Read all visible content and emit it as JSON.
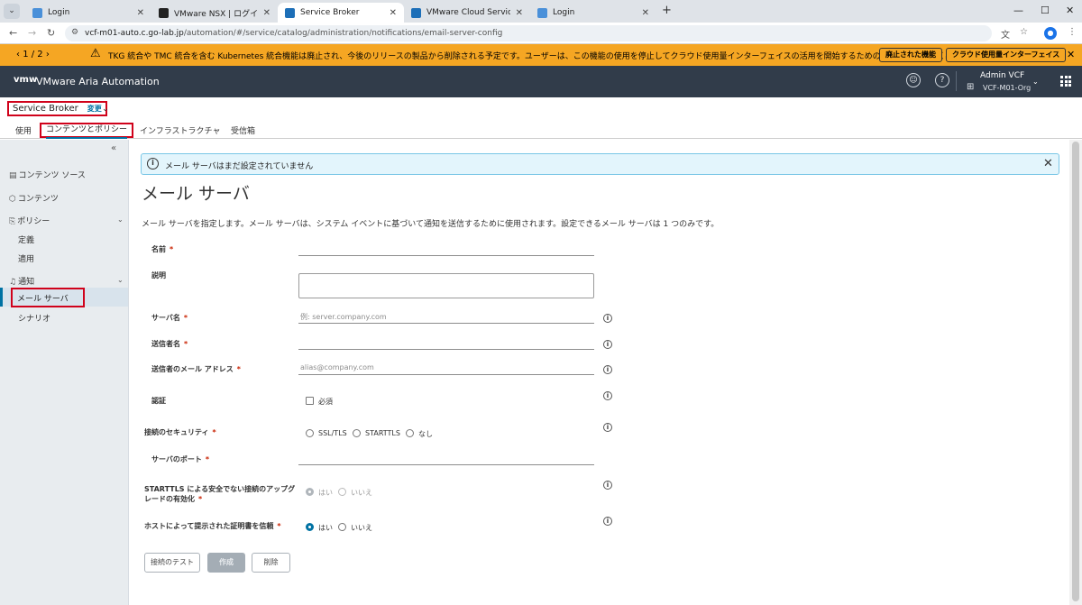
{
  "browser": {
    "tabs": [
      {
        "title": "Login",
        "favicon_color": "#4a90d9"
      },
      {
        "title": "VMware NSX | ログイン",
        "favicon_color": "#222222"
      },
      {
        "title": "Service Broker",
        "favicon_color": "#1d6fb8"
      },
      {
        "title": "VMware Cloud Services",
        "favicon_color": "#1d6fb8"
      },
      {
        "title": "Login",
        "favicon_color": "#4a90d9"
      }
    ],
    "url_host": "vcf-m01-auto.c.go-lab.jp",
    "url_path": "/automation/#/service/catalog/administration/notifications/email-server-config",
    "profile_initial": "👤"
  },
  "banner": {
    "pager": "1 / 2",
    "message": "TKG 統合や TMC 統合を含む Kubernetes 統合機能は廃止され、今後のリリースの製品から削除される予定です。ユーザーは、この機能の使用を停止してクラウド使用量インターフェイスの活用を開始するための計画を立てておく必要があります。",
    "button1": "廃止された機能",
    "button2": "クラウド使用量インターフェイス",
    "color": "#f5a623"
  },
  "app": {
    "logo": "vmw",
    "name": "VMware Aria Automation",
    "user": "Admin VCF",
    "org": "VCF-M01-Org",
    "header_color": "#313c4a"
  },
  "service": {
    "name": "Service Broker",
    "change": "変更"
  },
  "subtabs": [
    "使用",
    "コンテンツとポリシー",
    "インフラストラクチャ",
    "受信箱"
  ],
  "sidebar": {
    "content_source": "コンテンツ ソース",
    "content": "コンテンツ",
    "policy": "ポリシー",
    "policy_define": "定義",
    "policy_apply": "適用",
    "notification": "通知",
    "mail_server": "メール サーバ",
    "scenario": "シナリオ"
  },
  "alert": {
    "message": "メール サーバはまだ設定されていません"
  },
  "form": {
    "title": "メール サーバ",
    "description": "メール サーバを指定します。メール サーバは、システム イベントに基づいて通知を送信するために使用されます。設定できるメール サーバは 1 つのみです。",
    "name_label": "名前",
    "desc_label": "説明",
    "server_label": "サーバ名",
    "server_placeholder": "例: server.company.com",
    "sender_label": "送信者名",
    "sender_email_label": "送信者のメール アドレス",
    "sender_email_placeholder": "alias@company.com",
    "auth_label": "認証",
    "auth_required": "必須",
    "security_label": "接続のセキュリティ",
    "security_options": [
      "SSL/TLS",
      "STARTTLS",
      "なし"
    ],
    "port_label": "サーバのポート",
    "starttls_label_1": "STARTTLS による安全でない接続のアップグ",
    "starttls_label_2": "レードの有効化",
    "yes": "はい",
    "no": "いいえ",
    "trust_cert_label": "ホストによって提示された証明書を信頼",
    "starttls_selected": "はい",
    "trust_selected": "はい",
    "btn_test": "接続のテスト",
    "btn_create": "作成",
    "btn_delete": "削除",
    "required_mark": "*"
  }
}
